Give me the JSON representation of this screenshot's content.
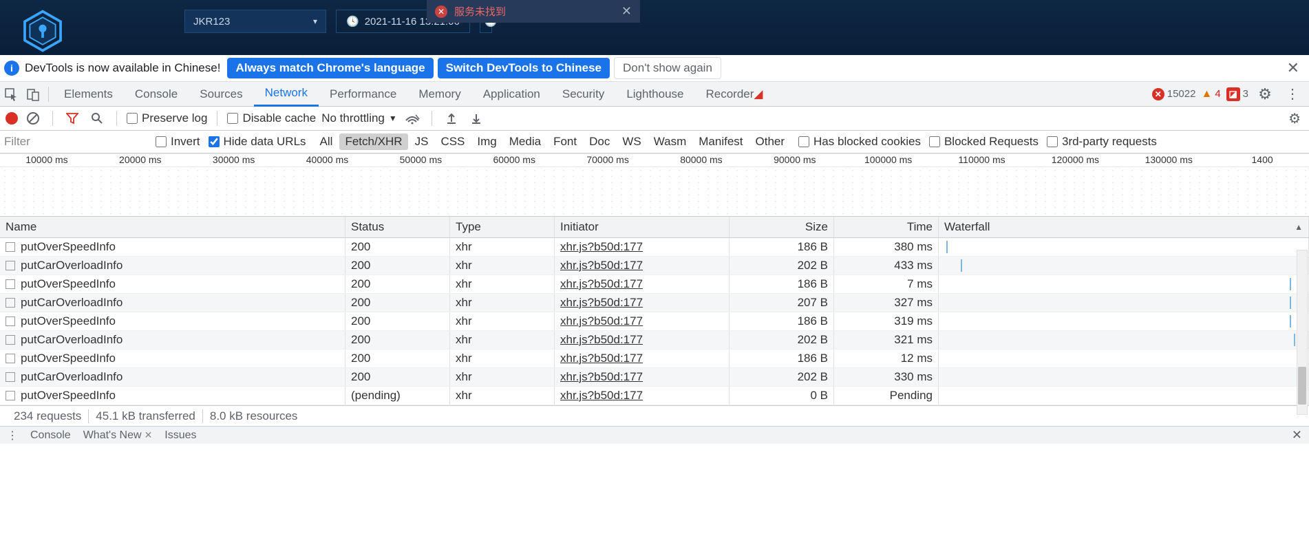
{
  "app": {
    "select_value": "JKR123",
    "datetime": "2021-11-16 13:21:06",
    "toast_text": "服务未找到"
  },
  "langbar": {
    "message": "DevTools is now available in Chinese!",
    "btn_match": "Always match Chrome's language",
    "btn_switch": "Switch DevTools to Chinese",
    "btn_dont": "Don't show again"
  },
  "tabs": {
    "items": [
      "Elements",
      "Console",
      "Sources",
      "Network",
      "Performance",
      "Memory",
      "Application",
      "Security",
      "Lighthouse",
      "Recorder"
    ],
    "active": "Network",
    "recorder_badge": true,
    "err_count": "15022",
    "warn_count": "4",
    "issue_count": "3"
  },
  "netToolbar": {
    "preserve": "Preserve log",
    "disable": "Disable cache",
    "throttle": "No throttling"
  },
  "filter": {
    "placeholder": "Filter",
    "invert": "Invert",
    "hide_urls": "Hide data URLs",
    "types": [
      "All",
      "Fetch/XHR",
      "JS",
      "CSS",
      "Img",
      "Media",
      "Font",
      "Doc",
      "WS",
      "Wasm",
      "Manifest",
      "Other"
    ],
    "active_type": "Fetch/XHR",
    "blocked_cookies": "Has blocked cookies",
    "blocked_req": "Blocked Requests",
    "third_party": "3rd-party requests"
  },
  "timeline": {
    "ticks": [
      "10000 ms",
      "20000 ms",
      "30000 ms",
      "40000 ms",
      "50000 ms",
      "60000 ms",
      "70000 ms",
      "80000 ms",
      "90000 ms",
      "100000 ms",
      "110000 ms",
      "120000 ms",
      "130000 ms",
      "1400"
    ]
  },
  "table": {
    "headers": {
      "name": "Name",
      "status": "Status",
      "type": "Type",
      "initiator": "Initiator",
      "size": "Size",
      "time": "Time",
      "waterfall": "Waterfall"
    },
    "rows": [
      {
        "name": "putOverSpeedInfo",
        "status": "200",
        "type": "xhr",
        "initiator": "xhr.js?b50d:177",
        "size": "186 B",
        "time": "380 ms",
        "wf": 2
      },
      {
        "name": "putCarOverloadInfo",
        "status": "200",
        "type": "xhr",
        "initiator": "xhr.js?b50d:177",
        "size": "202 B",
        "time": "433 ms",
        "wf": 6
      },
      {
        "name": "putOverSpeedInfo",
        "status": "200",
        "type": "xhr",
        "initiator": "xhr.js?b50d:177",
        "size": "186 B",
        "time": "7 ms",
        "wf": 95
      },
      {
        "name": "putCarOverloadInfo",
        "status": "200",
        "type": "xhr",
        "initiator": "xhr.js?b50d:177",
        "size": "207 B",
        "time": "327 ms",
        "wf": 95
      },
      {
        "name": "putOverSpeedInfo",
        "status": "200",
        "type": "xhr",
        "initiator": "xhr.js?b50d:177",
        "size": "186 B",
        "time": "319 ms",
        "wf": 95
      },
      {
        "name": "putCarOverloadInfo",
        "status": "200",
        "type": "xhr",
        "initiator": "xhr.js?b50d:177",
        "size": "202 B",
        "time": "321 ms",
        "wf": 96
      },
      {
        "name": "putOverSpeedInfo",
        "status": "200",
        "type": "xhr",
        "initiator": "xhr.js?b50d:177",
        "size": "186 B",
        "time": "12 ms",
        "wf": 97
      },
      {
        "name": "putCarOverloadInfo",
        "status": "200",
        "type": "xhr",
        "initiator": "xhr.js?b50d:177",
        "size": "202 B",
        "time": "330 ms",
        "wf": 97
      },
      {
        "name": "putOverSpeedInfo",
        "status": "(pending)",
        "type": "xhr",
        "initiator": "xhr.js?b50d:177",
        "size": "0 B",
        "time": "Pending",
        "wf": 98
      }
    ]
  },
  "status": {
    "requests": "234 requests",
    "transferred": "45.1 kB transferred",
    "resources": "8.0 kB resources"
  },
  "drawer": {
    "tabs": [
      "Console",
      "What's New",
      "Issues"
    ]
  }
}
